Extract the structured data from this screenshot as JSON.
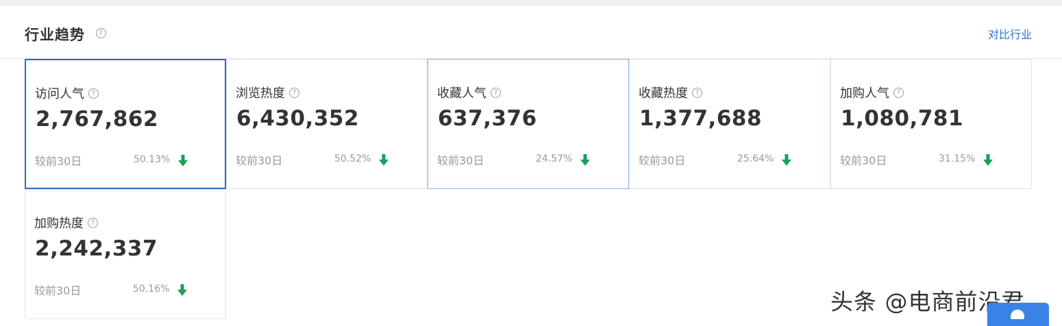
{
  "header": {
    "title": "行业趋势",
    "help_glyph": "?",
    "compare_link": "对比行业"
  },
  "cards": [
    {
      "label": "访问人气",
      "value": "2,767,862",
      "compare_label": "较前30日",
      "change": "50.13%",
      "trend": "down",
      "state": "selected"
    },
    {
      "label": "浏览热度",
      "value": "6,430,352",
      "compare_label": "较前30日",
      "change": "50.52%",
      "trend": "down",
      "state": "default"
    },
    {
      "label": "收藏人气",
      "value": "637,376",
      "compare_label": "较前30日",
      "change": "24.57%",
      "trend": "down",
      "state": "hovered"
    },
    {
      "label": "收藏热度",
      "value": "1,377,688",
      "compare_label": "较前30日",
      "change": "25.64%",
      "trend": "down",
      "state": "default"
    },
    {
      "label": "加购人气",
      "value": "1,080,781",
      "compare_label": "较前30日",
      "change": "31.15%",
      "trend": "down",
      "state": "default"
    },
    {
      "label": "加购热度",
      "value": "2,242,337",
      "compare_label": "较前30日",
      "change": "50.16%",
      "trend": "down",
      "state": "default"
    }
  ],
  "colors": {
    "accent": "#2f6ac4",
    "link": "#2c6fca",
    "down_arrow": "#1aa05a",
    "border": "#dfe6ee"
  },
  "icons": {
    "help": "question-circle-icon",
    "trend_down": "arrow-down-icon"
  },
  "watermark": {
    "text": "头条 @电商前沿君"
  }
}
